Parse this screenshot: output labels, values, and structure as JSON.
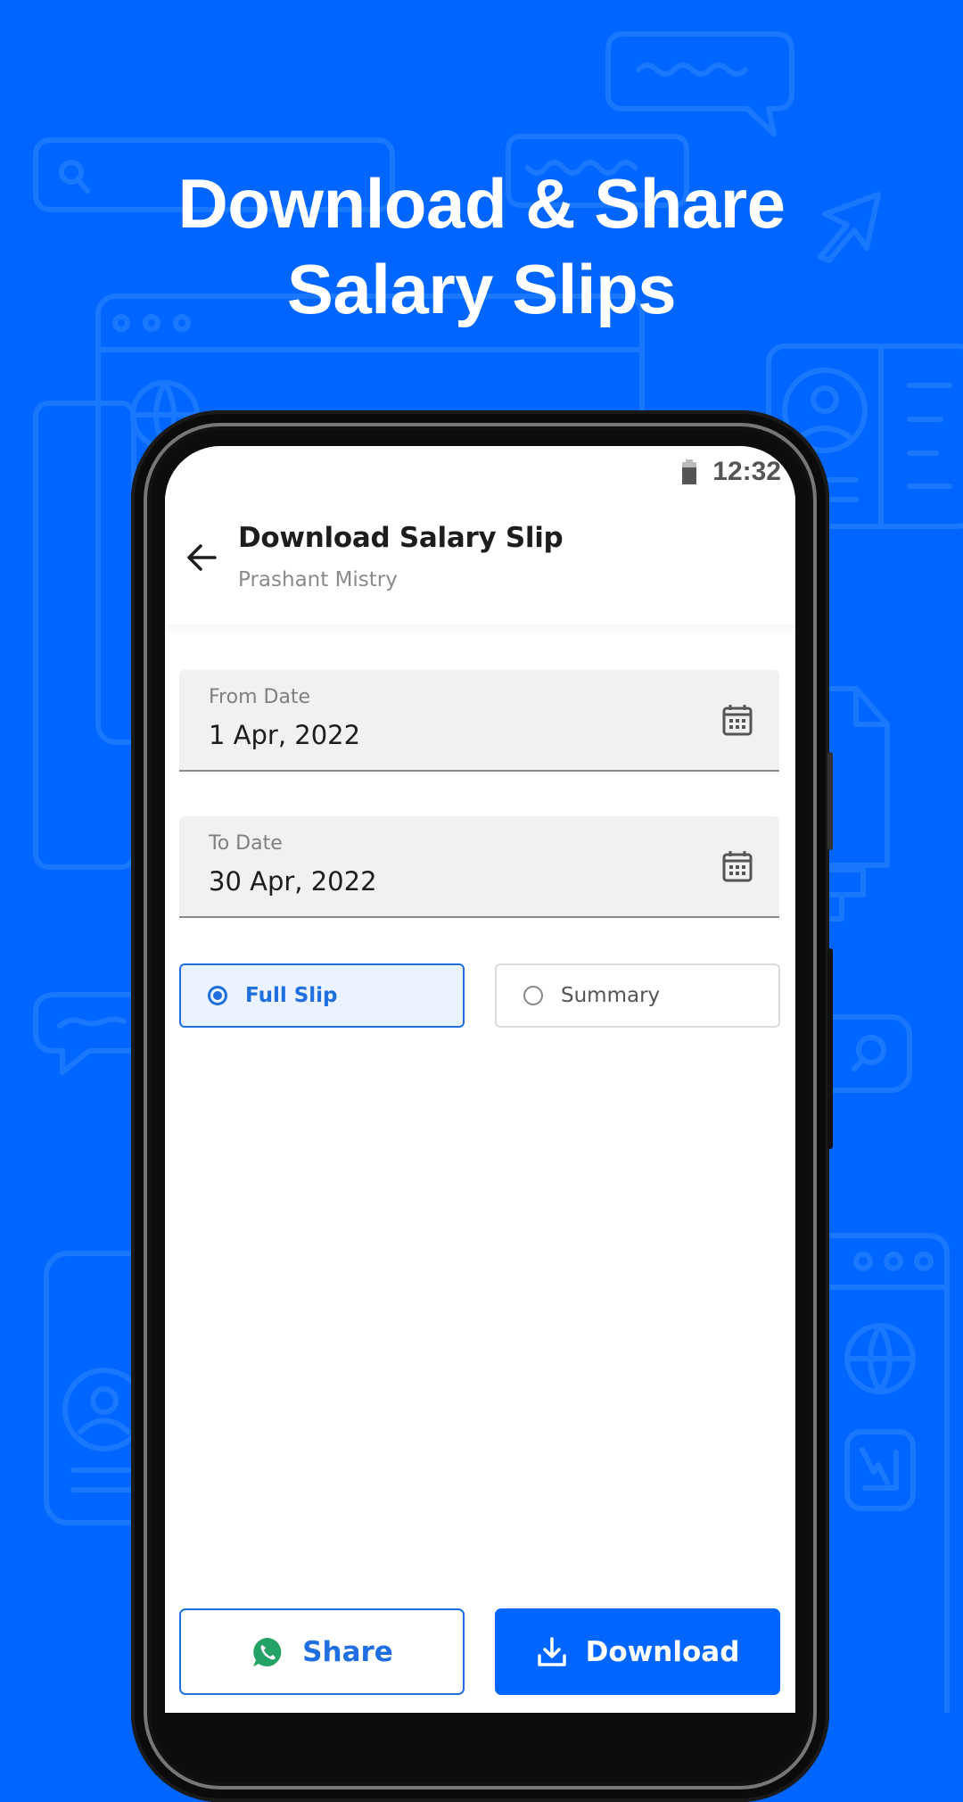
{
  "promo": {
    "headline_line1": "Download & Share",
    "headline_line2": "Salary Slips",
    "background_color": "#0066FF"
  },
  "status_bar": {
    "battery_icon": "battery-icon",
    "time": "12:32"
  },
  "app_bar": {
    "back_icon": "arrow-left-icon",
    "title": "Download Salary Slip",
    "subtitle": "Prashant Mistry"
  },
  "form": {
    "from_date": {
      "label": "From Date",
      "value": "1 Apr, 2022",
      "icon": "calendar-icon"
    },
    "to_date": {
      "label": "To Date",
      "value": "30 Apr, 2022",
      "icon": "calendar-icon"
    },
    "slip_type": {
      "options": [
        {
          "label": "Full Slip",
          "selected": true
        },
        {
          "label": "Summary",
          "selected": false
        }
      ]
    }
  },
  "actions": {
    "share_label": "Share",
    "share_icon": "whatsapp-icon",
    "download_label": "Download",
    "download_icon": "download-icon",
    "accent_color": "#1F6FE0",
    "whatsapp_color": "#25A366"
  }
}
